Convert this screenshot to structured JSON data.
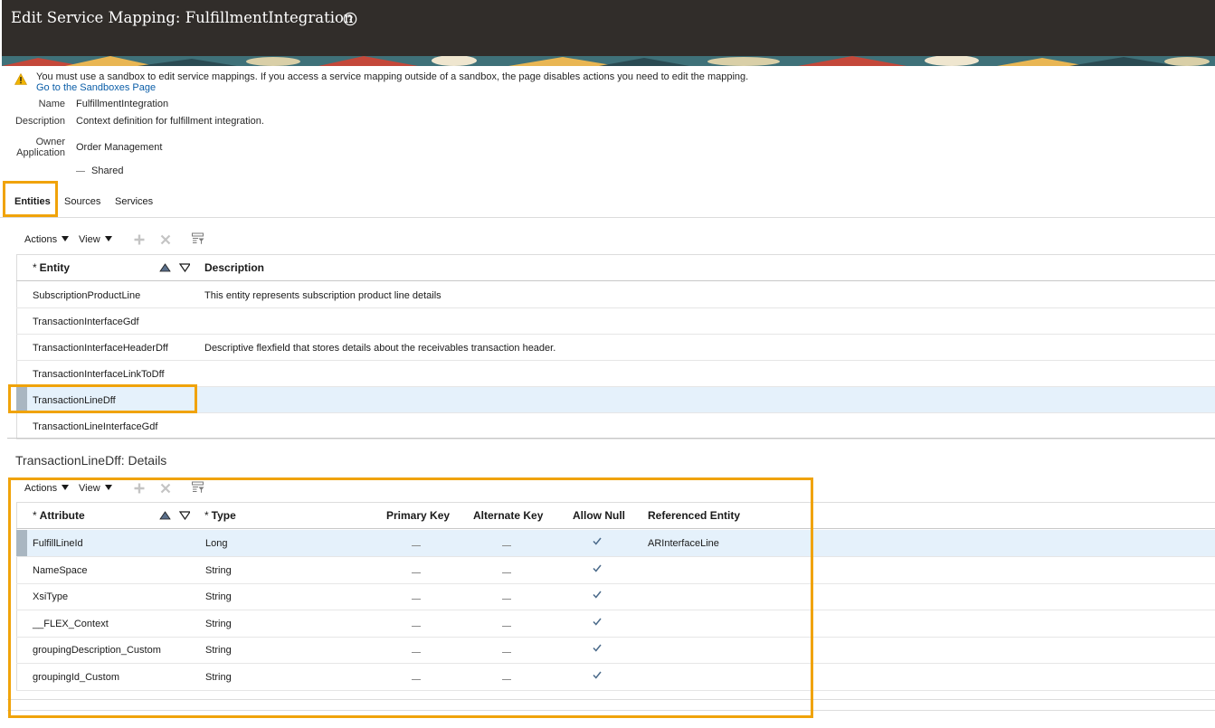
{
  "page": {
    "title": "Edit Service Mapping: FulfillmentIntegration"
  },
  "warning": {
    "message": "You must use a sandbox to edit service mappings. If you access a service mapping outside of a sandbox, the page disables actions you need to edit the mapping.",
    "link": "Go to the Sandboxes Page"
  },
  "details": {
    "name_label": "Name",
    "name_value": "FulfillmentIntegration",
    "description_label": "Description",
    "description_value": "Context definition for fulfillment integration.",
    "owner_label_line1": "Owner",
    "owner_label_line2": "Application",
    "owner_value": "Order Management",
    "shared_label": "Shared"
  },
  "tabs": [
    {
      "label": "Entities",
      "active": true
    },
    {
      "label": "Sources",
      "active": false
    },
    {
      "label": "Services",
      "active": false
    }
  ],
  "toolbar": {
    "actions_label": "Actions",
    "view_label": "View"
  },
  "entities": {
    "columns": {
      "required_mark": "*",
      "entity": "Entity",
      "description": "Description"
    },
    "rows": [
      {
        "entity": "SubscriptionProductLine",
        "description": "This entity represents subscription product line details"
      },
      {
        "entity": "TransactionInterfaceGdf",
        "description": ""
      },
      {
        "entity": "TransactionInterfaceHeaderDff",
        "description": "Descriptive flexfield that stores details about the receivables transaction header."
      },
      {
        "entity": "TransactionInterfaceLinkToDff",
        "description": ""
      },
      {
        "entity": "TransactionLineDff",
        "description": "",
        "selected": true
      },
      {
        "entity": "TransactionLineInterfaceGdf",
        "description": ""
      }
    ]
  },
  "details_section": {
    "title": "TransactionLineDff: Details",
    "columns": {
      "required_mark": "*",
      "attribute": "Attribute",
      "type": "Type",
      "primary_key": "Primary Key",
      "alternate_key": "Alternate Key",
      "allow_null": "Allow Null",
      "referenced_entity": "Referenced Entity"
    },
    "rows": [
      {
        "attribute": "FulfillLineId",
        "type": "Long",
        "allow_null": true,
        "referenced_entity": "ARInterfaceLine",
        "selected": true
      },
      {
        "attribute": "NameSpace",
        "type": "String",
        "allow_null": true,
        "referenced_entity": ""
      },
      {
        "attribute": "XsiType",
        "type": "String",
        "allow_null": true,
        "referenced_entity": ""
      },
      {
        "attribute": "__FLEX_Context",
        "type": "String",
        "allow_null": true,
        "referenced_entity": ""
      },
      {
        "attribute": "groupingDescription_Custom",
        "type": "String",
        "allow_null": true,
        "referenced_entity": ""
      },
      {
        "attribute": "groupingId_Custom",
        "type": "String",
        "allow_null": true,
        "referenced_entity": ""
      }
    ]
  },
  "colors": {
    "header_bg": "#312d2a",
    "highlight": "#f0a30a",
    "selected_row": "#e5f1fb",
    "link": "#0b5ea8"
  },
  "icons": {
    "help": "help-circle-icon",
    "warning": "warning-triangle-icon",
    "add": "plus-icon",
    "delete": "close-icon",
    "filter": "query-by-example-icon",
    "sort": "sort-ascending-descending-icon",
    "check": "checkmark-icon"
  }
}
